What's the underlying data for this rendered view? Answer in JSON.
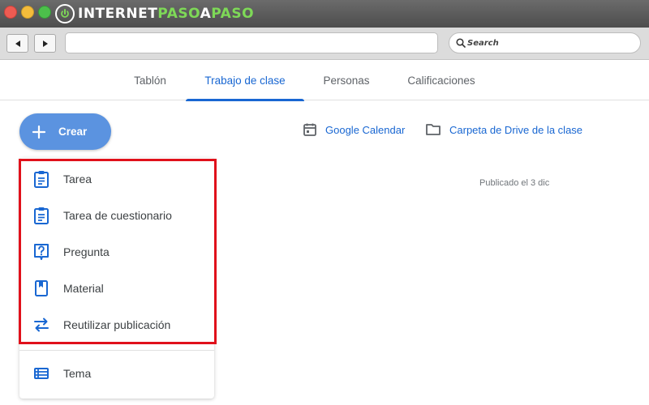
{
  "browser": {
    "logo": {
      "part1": "INTERNET",
      "part2": "PASO",
      "part3": "A",
      "part4": "PASO"
    },
    "url": "",
    "search_placeholder": "Search"
  },
  "tabs": [
    {
      "label": "Tablón",
      "active": false
    },
    {
      "label": "Trabajo de clase",
      "active": true
    },
    {
      "label": "Personas",
      "active": false
    },
    {
      "label": "Calificaciones",
      "active": false
    }
  ],
  "create_button": {
    "label": "Crear",
    "icon": "plus-icon"
  },
  "links": {
    "calendar": {
      "label": "Google Calendar",
      "icon": "calendar-icon"
    },
    "drive": {
      "label": "Carpeta de Drive de la clase",
      "icon": "folder-icon"
    }
  },
  "published_text": "Publicado el 3 dic",
  "menu": {
    "items": [
      {
        "label": "Tarea",
        "icon": "assignment-icon"
      },
      {
        "label": "Tarea de cuestionario",
        "icon": "quiz-assignment-icon"
      },
      {
        "label": "Pregunta",
        "icon": "question-icon"
      },
      {
        "label": "Material",
        "icon": "material-icon"
      },
      {
        "label": "Reutilizar publicación",
        "icon": "reuse-post-icon"
      }
    ],
    "topic": {
      "label": "Tema",
      "icon": "topic-list-icon"
    }
  },
  "colors": {
    "accent": "#1967d2",
    "create_button": "#5b93e0",
    "highlight": "#e0111b",
    "logo_green": "#7ed957"
  }
}
